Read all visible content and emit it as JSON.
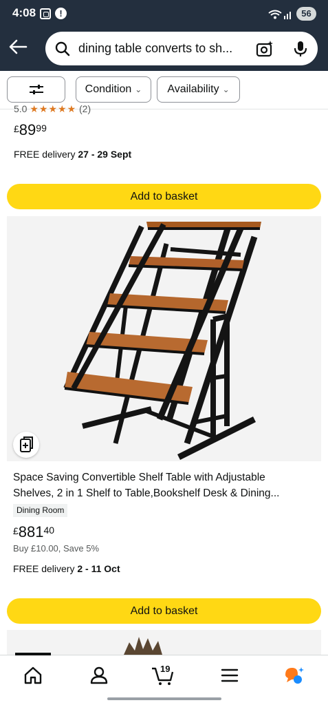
{
  "status_bar": {
    "time": "4:08",
    "battery": "56"
  },
  "search": {
    "query": "dining table converts to sh..."
  },
  "filters": {
    "condition": "Condition",
    "availability": "Availability"
  },
  "result1": {
    "rating_fragment": "5.0",
    "stars": "★★★★★",
    "review_count": "(2)",
    "price_currency": "£",
    "price_whole": "89",
    "price_fraction": "99",
    "delivery_prefix": "FREE delivery ",
    "delivery_dates": "27 - 29 Sept",
    "add_label": "Add to basket"
  },
  "result2": {
    "title": "Space Saving Convertible Shelf Table with Adjustable Shelves, 2 in 1 Shelf to Table,Bookshelf Desk & Dining...",
    "badge": "Dining Room",
    "price_currency": "£",
    "price_whole": "881",
    "price_fraction": "40",
    "subprice": "Buy £10.00, Save 5%",
    "delivery_prefix": "FREE delivery ",
    "delivery_dates": "2 - 11 Oct",
    "add_label": "Add to basket"
  },
  "bottom_nav": {
    "cart_count": "19",
    "icons": [
      "home-icon",
      "account-icon",
      "cart-icon",
      "menu-icon",
      "rufus-icon"
    ]
  },
  "colors": {
    "header": "#232f3e",
    "basket_button": "#ffd814",
    "stars": "#de7921",
    "rufus_orange": "#ff7a1a",
    "rufus_blue": "#1a8cff"
  }
}
